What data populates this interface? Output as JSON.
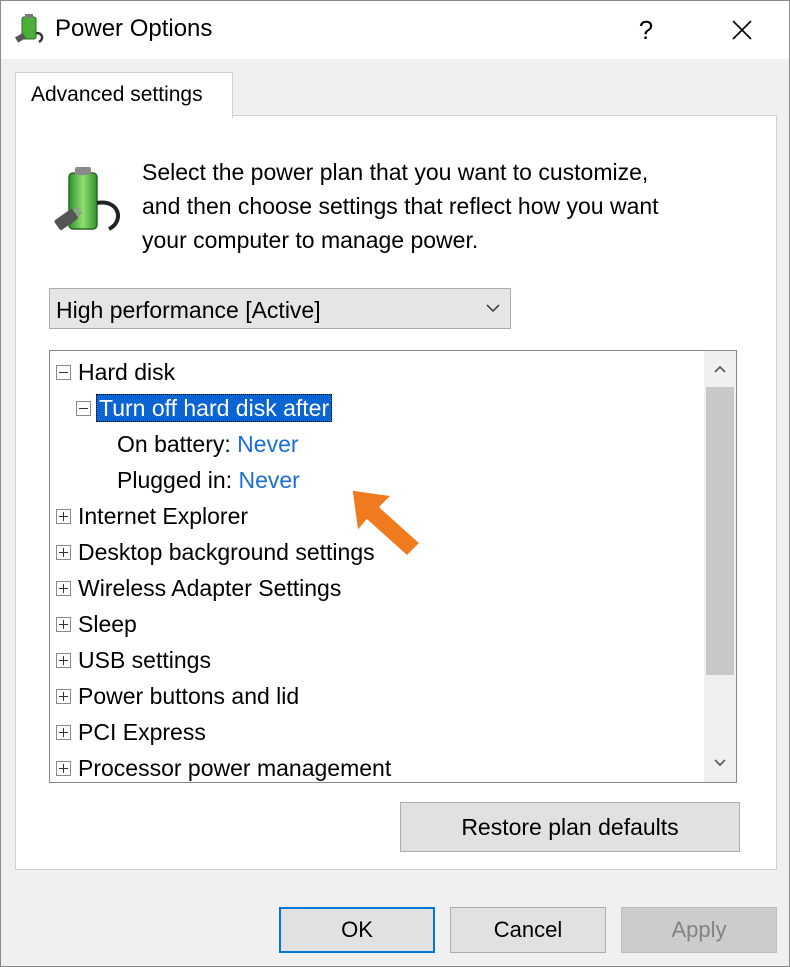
{
  "window": {
    "title": "Power Options",
    "help_label": "?",
    "close_label": "✕"
  },
  "tab": {
    "label": "Advanced settings"
  },
  "intro": {
    "line1": "Select the power plan that you want to customize,",
    "line2": "and then choose settings that reflect how you want",
    "line3": "your computer to manage power."
  },
  "plan_select": {
    "value": "High performance [Active]"
  },
  "tree": {
    "hard_disk": "Hard disk",
    "turn_off": "Turn off hard disk after",
    "on_battery_label": "On battery:",
    "on_battery_value": "Never",
    "plugged_in_label": "Plugged in:",
    "plugged_in_value": "Never",
    "items": [
      "Internet Explorer",
      "Desktop background settings",
      "Wireless Adapter Settings",
      "Sleep",
      "USB settings",
      "Power buttons and lid",
      "PCI Express",
      "Processor power management"
    ]
  },
  "buttons": {
    "restore": "Restore plan defaults",
    "ok": "OK",
    "cancel": "Cancel",
    "apply": "Apply"
  },
  "colors": {
    "selection": "#0a64d2",
    "value_link": "#1a6ed8",
    "highlight_arrow": "#f07a1e",
    "default_button_border": "#0078d7"
  },
  "icons": {
    "title": "power-plug-battery-icon",
    "plan": "power-plug-battery-icon",
    "close": "close-icon",
    "help": "help-icon"
  }
}
